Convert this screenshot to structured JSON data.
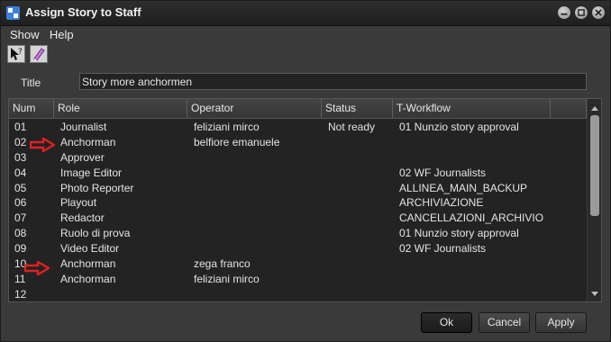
{
  "window": {
    "title": "Assign Story to Staff"
  },
  "menu": [
    "Show",
    "Help"
  ],
  "toolbar": {
    "buttons": [
      "help-pointer-icon",
      "eraser-icon"
    ]
  },
  "form": {
    "title_label": "Title",
    "title_value": "Story more anchormen"
  },
  "table": {
    "columns": [
      "Num",
      "Role",
      "Operator",
      "Status",
      "T-Workflow"
    ],
    "rows": [
      {
        "num": "01",
        "role": "Journalist",
        "operator": "feliziani mirco",
        "status": "Not ready",
        "workflow": "01 Nunzio story approval"
      },
      {
        "num": "02",
        "role": "Anchorman",
        "operator": "belfiore emanuele",
        "status": "",
        "workflow": ""
      },
      {
        "num": "03",
        "role": "Approver",
        "operator": "",
        "status": "",
        "workflow": ""
      },
      {
        "num": "04",
        "role": "Image Editor",
        "operator": "",
        "status": "",
        "workflow": "02 WF Journalists"
      },
      {
        "num": "05",
        "role": "Photo Reporter",
        "operator": "",
        "status": "",
        "workflow": "ALLINEA_MAIN_BACKUP"
      },
      {
        "num": "06",
        "role": "Playout",
        "operator": "",
        "status": "",
        "workflow": "ARCHIVIAZIONE"
      },
      {
        "num": "07",
        "role": "Redactor",
        "operator": "",
        "status": "",
        "workflow": "CANCELLAZIONI_ARCHIVIO"
      },
      {
        "num": "08",
        "role": "Ruolo di prova",
        "operator": "",
        "status": "",
        "workflow": "01 Nunzio story approval"
      },
      {
        "num": "09",
        "role": "Video Editor",
        "operator": "",
        "status": "",
        "workflow": "02 WF Journalists"
      },
      {
        "num": "10",
        "role": "Anchorman",
        "operator": "zega franco",
        "status": "",
        "workflow": ""
      },
      {
        "num": "11",
        "role": "Anchorman",
        "operator": "feliziani mirco",
        "status": "",
        "workflow": ""
      },
      {
        "num": "12",
        "role": "",
        "operator": "",
        "status": "",
        "workflow": ""
      }
    ]
  },
  "buttons": {
    "ok": "Ok",
    "cancel": "Cancel",
    "apply": "Apply"
  },
  "colors": {
    "annotation_arrow": "#e02020",
    "window_bg": "#3a3a3a",
    "grid_bg": "#232323"
  }
}
